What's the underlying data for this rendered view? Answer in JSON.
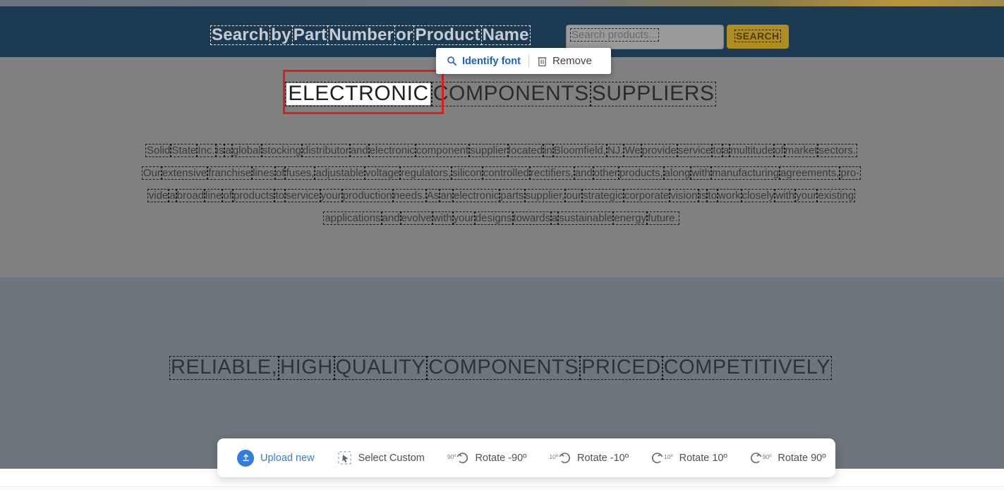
{
  "site_header": {
    "label_words": [
      "Search",
      "by",
      "Part",
      "Number",
      "or",
      "Product",
      "Name"
    ],
    "search_input_placeholder": "Search products...",
    "search_button_label": "SEARCH"
  },
  "headings": {
    "h1_words": [
      "ELECTRONIC",
      "COMPONENTS",
      "SUPPLIERS"
    ],
    "h1_selected_word": "ELECTRONIC",
    "h2_words": [
      "RELIABLE,",
      "HIGH",
      "QUALITY",
      "COMPONENTS",
      "PRICED",
      "COMPETITIVELY"
    ]
  },
  "paragraph": {
    "lines": [
      [
        "Solid",
        "State",
        "Inc.",
        "is",
        "a",
        "global",
        "stocking",
        "distributor",
        "and",
        "electronic",
        "component",
        "supplier",
        "located",
        "in",
        "Bloomfield,",
        "NJ.",
        "We",
        "provide",
        "service",
        "to",
        "a",
        "multitude",
        "of",
        "market",
        "sectors."
      ],
      [
        "Our",
        "extensive",
        "franchise",
        "lines",
        "of",
        "fuses,",
        "adjustable",
        "voltage",
        "regulators,",
        "silicon",
        "controlled",
        "rectifiers,",
        "and",
        "other",
        "products,",
        "along",
        "with",
        "manufacturing",
        "agreements,",
        "pro-"
      ],
      [
        "vide",
        "a",
        "broad",
        "line",
        "of",
        "products",
        "to",
        "service",
        "your",
        "production",
        "needs.",
        "As",
        "an",
        "electronic",
        "parts",
        "supplier,",
        "our",
        "strategic",
        "corporate",
        "vision",
        "is",
        "to",
        "work",
        "closely",
        "with",
        "your",
        "existing"
      ],
      [
        "applications",
        "and",
        "evolve",
        "with",
        "your",
        "designs",
        "towards",
        "a",
        "sustainable",
        "energy",
        "future."
      ]
    ]
  },
  "popup": {
    "identify_font_label": "Identify font",
    "remove_label": "Remove"
  },
  "toolbar": {
    "upload_label": "Upload new",
    "select_custom_label": "Select Custom",
    "rotate_minus_90_label": "Rotate -90º",
    "rotate_minus_90_badge": "90º",
    "rotate_minus_10_label": "Rotate -10º",
    "rotate_minus_10_badge": "10º",
    "rotate_plus_10_label": "Rotate 10º",
    "rotate_plus_10_badge": "10º",
    "rotate_plus_90_label": "Rotate 90º",
    "rotate_plus_90_badge": "90º"
  },
  "colors": {
    "header_navy": "#1d3a53",
    "search_gold": "#b08d21",
    "accent_blue": "#2f7de1",
    "selection_red": "#e01b1b"
  }
}
